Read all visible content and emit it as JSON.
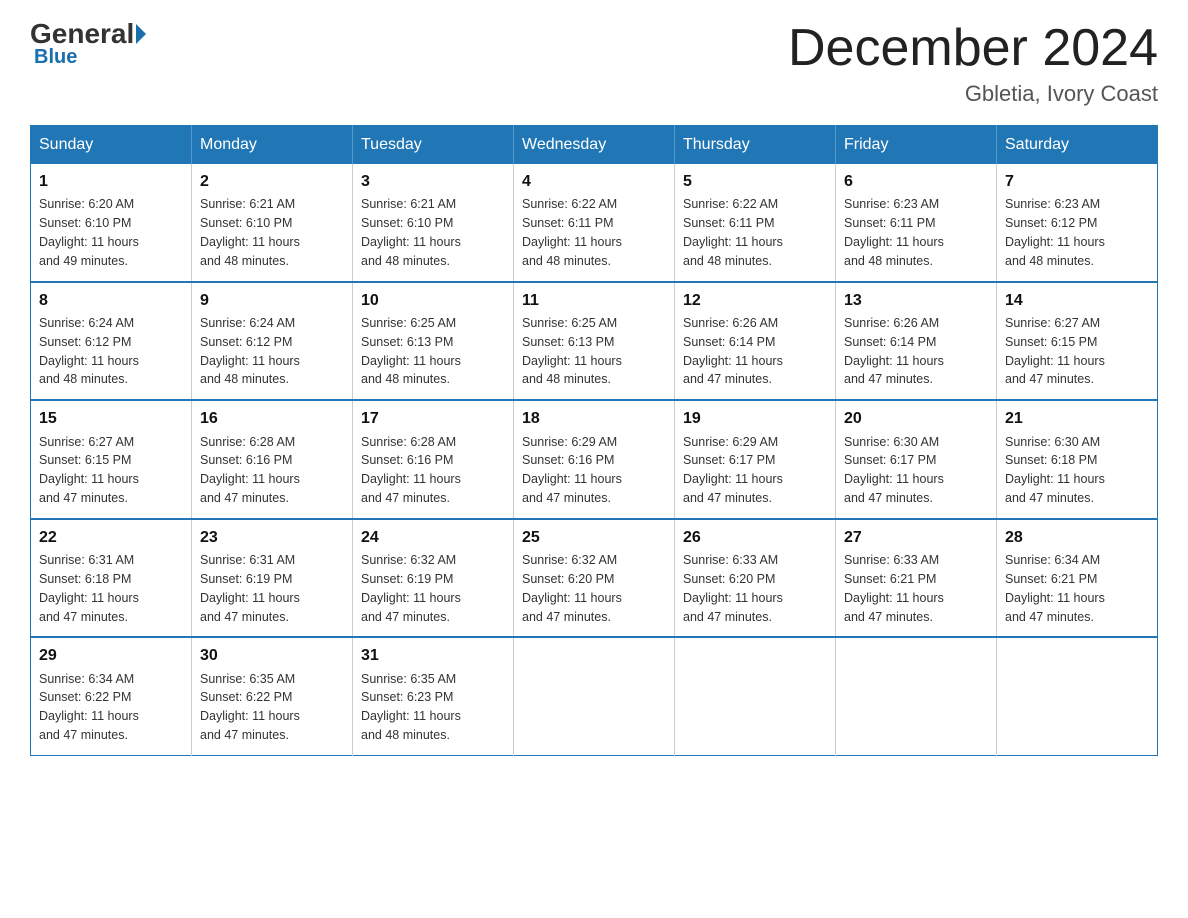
{
  "logo": {
    "general": "General",
    "blue": "Blue",
    "tagline": "Blue"
  },
  "title": {
    "month": "December 2024",
    "location": "Gbletia, Ivory Coast"
  },
  "headers": [
    "Sunday",
    "Monday",
    "Tuesday",
    "Wednesday",
    "Thursday",
    "Friday",
    "Saturday"
  ],
  "weeks": [
    [
      {
        "day": "1",
        "sunrise": "6:20 AM",
        "sunset": "6:10 PM",
        "daylight": "11 hours and 49 minutes."
      },
      {
        "day": "2",
        "sunrise": "6:21 AM",
        "sunset": "6:10 PM",
        "daylight": "11 hours and 48 minutes."
      },
      {
        "day": "3",
        "sunrise": "6:21 AM",
        "sunset": "6:10 PM",
        "daylight": "11 hours and 48 minutes."
      },
      {
        "day": "4",
        "sunrise": "6:22 AM",
        "sunset": "6:11 PM",
        "daylight": "11 hours and 48 minutes."
      },
      {
        "day": "5",
        "sunrise": "6:22 AM",
        "sunset": "6:11 PM",
        "daylight": "11 hours and 48 minutes."
      },
      {
        "day": "6",
        "sunrise": "6:23 AM",
        "sunset": "6:11 PM",
        "daylight": "11 hours and 48 minutes."
      },
      {
        "day": "7",
        "sunrise": "6:23 AM",
        "sunset": "6:12 PM",
        "daylight": "11 hours and 48 minutes."
      }
    ],
    [
      {
        "day": "8",
        "sunrise": "6:24 AM",
        "sunset": "6:12 PM",
        "daylight": "11 hours and 48 minutes."
      },
      {
        "day": "9",
        "sunrise": "6:24 AM",
        "sunset": "6:12 PM",
        "daylight": "11 hours and 48 minutes."
      },
      {
        "day": "10",
        "sunrise": "6:25 AM",
        "sunset": "6:13 PM",
        "daylight": "11 hours and 48 minutes."
      },
      {
        "day": "11",
        "sunrise": "6:25 AM",
        "sunset": "6:13 PM",
        "daylight": "11 hours and 48 minutes."
      },
      {
        "day": "12",
        "sunrise": "6:26 AM",
        "sunset": "6:14 PM",
        "daylight": "11 hours and 47 minutes."
      },
      {
        "day": "13",
        "sunrise": "6:26 AM",
        "sunset": "6:14 PM",
        "daylight": "11 hours and 47 minutes."
      },
      {
        "day": "14",
        "sunrise": "6:27 AM",
        "sunset": "6:15 PM",
        "daylight": "11 hours and 47 minutes."
      }
    ],
    [
      {
        "day": "15",
        "sunrise": "6:27 AM",
        "sunset": "6:15 PM",
        "daylight": "11 hours and 47 minutes."
      },
      {
        "day": "16",
        "sunrise": "6:28 AM",
        "sunset": "6:16 PM",
        "daylight": "11 hours and 47 minutes."
      },
      {
        "day": "17",
        "sunrise": "6:28 AM",
        "sunset": "6:16 PM",
        "daylight": "11 hours and 47 minutes."
      },
      {
        "day": "18",
        "sunrise": "6:29 AM",
        "sunset": "6:16 PM",
        "daylight": "11 hours and 47 minutes."
      },
      {
        "day": "19",
        "sunrise": "6:29 AM",
        "sunset": "6:17 PM",
        "daylight": "11 hours and 47 minutes."
      },
      {
        "day": "20",
        "sunrise": "6:30 AM",
        "sunset": "6:17 PM",
        "daylight": "11 hours and 47 minutes."
      },
      {
        "day": "21",
        "sunrise": "6:30 AM",
        "sunset": "6:18 PM",
        "daylight": "11 hours and 47 minutes."
      }
    ],
    [
      {
        "day": "22",
        "sunrise": "6:31 AM",
        "sunset": "6:18 PM",
        "daylight": "11 hours and 47 minutes."
      },
      {
        "day": "23",
        "sunrise": "6:31 AM",
        "sunset": "6:19 PM",
        "daylight": "11 hours and 47 minutes."
      },
      {
        "day": "24",
        "sunrise": "6:32 AM",
        "sunset": "6:19 PM",
        "daylight": "11 hours and 47 minutes."
      },
      {
        "day": "25",
        "sunrise": "6:32 AM",
        "sunset": "6:20 PM",
        "daylight": "11 hours and 47 minutes."
      },
      {
        "day": "26",
        "sunrise": "6:33 AM",
        "sunset": "6:20 PM",
        "daylight": "11 hours and 47 minutes."
      },
      {
        "day": "27",
        "sunrise": "6:33 AM",
        "sunset": "6:21 PM",
        "daylight": "11 hours and 47 minutes."
      },
      {
        "day": "28",
        "sunrise": "6:34 AM",
        "sunset": "6:21 PM",
        "daylight": "11 hours and 47 minutes."
      }
    ],
    [
      {
        "day": "29",
        "sunrise": "6:34 AM",
        "sunset": "6:22 PM",
        "daylight": "11 hours and 47 minutes."
      },
      {
        "day": "30",
        "sunrise": "6:35 AM",
        "sunset": "6:22 PM",
        "daylight": "11 hours and 47 minutes."
      },
      {
        "day": "31",
        "sunrise": "6:35 AM",
        "sunset": "6:23 PM",
        "daylight": "11 hours and 48 minutes."
      },
      null,
      null,
      null,
      null
    ]
  ],
  "labels": {
    "sunrise": "Sunrise:",
    "sunset": "Sunset:",
    "daylight": "Daylight:"
  }
}
